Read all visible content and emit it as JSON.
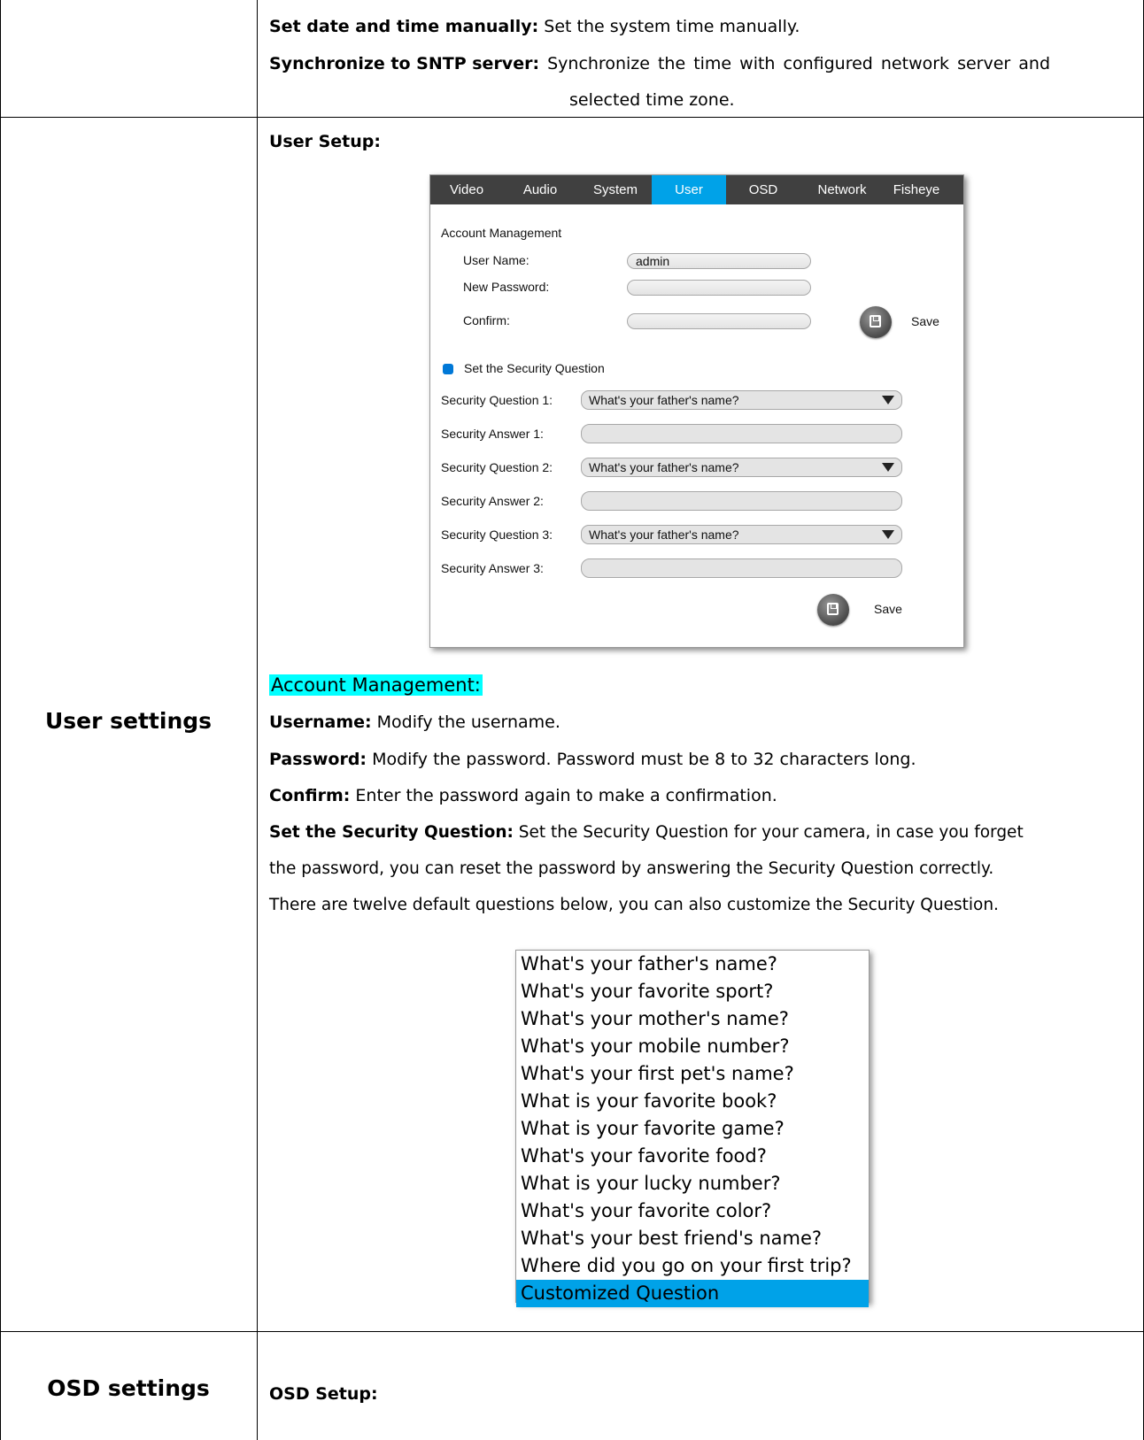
{
  "row1": {
    "line1_bold": "Set date and time manually:",
    "line1_text": " Set the system time manually.",
    "line2_bold": "Synchronize to SNTP server:",
    "line2_text": " Synchronize the time with configured network server and",
    "line3_text": "selected time zone."
  },
  "row2": {
    "left_label": "User settings",
    "heading": "User Setup:",
    "ui": {
      "tabs": [
        "Video",
        "Audio",
        "System",
        "User",
        "OSD",
        "Network",
        "Fisheye"
      ],
      "active_tab": "User",
      "section_title": "Account Management",
      "user_name_label": "User Name:",
      "user_name_value": "admin",
      "new_password_label": "New Password:",
      "confirm_label": "Confirm:",
      "save_label": "Save",
      "security_checkbox_label": "Set the Security Question",
      "question1_label": "Security Question 1:",
      "question1_value": "What's your father's name?",
      "answer1_label": "Security Answer 1:",
      "question2_label": "Security Question 2:",
      "question2_value": "What's your father's name?",
      "answer2_label": "Security Answer 2:",
      "question3_label": "Security Question 3:",
      "question3_value": "What's your father's name?",
      "answer3_label": "Security Answer 3:",
      "save2_label": "Save",
      "accent_color": "#00a2e8"
    },
    "account_heading": "Account Management:",
    "username_bold": "Username:",
    "username_text": " Modify the username.",
    "password_bold": "Password:",
    "password_text": " Modify the password. Password must be 8 to 32 characters long.",
    "confirm_bold": "Confirm:",
    "confirm_text": " Enter the password again to make a confirmation.",
    "security_bold": "Set the Security Question:",
    "security_text": " Set the Security Question for your camera, in case you forget",
    "security_line2": "the password, you can reset the password by answering the Security Question correctly.",
    "security_line3": "There are twelve default questions below, you can also customize the Security Question.",
    "questions": [
      "What's your father's name?",
      "What's your favorite sport?",
      "What's your mother's name?",
      "What's your mobile number?",
      "What's your first pet's name?",
      "What is your favorite book?",
      "What is your favorite game?",
      "What's your favorite food?",
      "What is your lucky number?",
      "What's your favorite color?",
      "What's your best friend's name?",
      "Where did you go on your first trip?",
      "Customized Question"
    ],
    "selected_question": "Customized Question"
  },
  "row3": {
    "left_label": "OSD settings",
    "heading": "OSD Setup:"
  }
}
